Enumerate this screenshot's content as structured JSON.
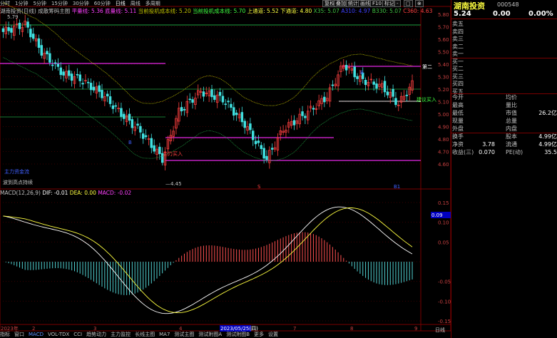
{
  "toolbar": {
    "periods": [
      "分时",
      "1分钟",
      "5分钟",
      "15分钟",
      "30分钟",
      "60分钟",
      "日线",
      "周线",
      "多周期"
    ],
    "selected": "日线",
    "buttons": [
      "复权",
      "叠加",
      "统计",
      "画线",
      "F10",
      "标记",
      "-",
      "□",
      "⊗"
    ]
  },
  "legend_top": {
    "name": "湖南投资(日线)",
    "indicator": "成散筹码主图",
    "items": [
      {
        "label": "平量线:",
        "value": "5.36",
        "color": "#ff40ff"
      },
      {
        "label": "底量线:",
        "value": "5.11",
        "color": "#ff40ff"
      },
      {
        "label": "当前投机成本线:",
        "value": "5.20",
        "color": "#c0c000"
      },
      {
        "label": "当前投机成本线:",
        "value": "5.70",
        "color": "#40ff40"
      },
      {
        "label": "上通道:",
        "value": "5.52",
        "color": "#ffff40"
      },
      {
        "label": "下通道:",
        "value": "4.80",
        "color": "#ffff40"
      },
      {
        "label": "X35:",
        "value": "5.07",
        "color": "#40c040"
      },
      {
        "label": "A310:",
        "value": "4.97",
        "color": "#4040ff"
      },
      {
        "label": "B330:",
        "value": "5.07",
        "color": "#40c040"
      },
      {
        "label": "C360:",
        "value": "4.63",
        "color": "#ff4040"
      }
    ]
  },
  "price_axis": [
    "5.80",
    "5.70",
    "5.60",
    "5.50",
    "5.40",
    "5.30",
    "5.20",
    "5.10",
    "5.00",
    "4.90",
    "4.80",
    "4.70",
    "4.60"
  ],
  "macd_axis": [
    "0.15",
    "0.10",
    "0.05",
    "0.09",
    "-0.05",
    "-0.10",
    "-0.15"
  ],
  "annotations": {
    "high": "5.79",
    "low": "4.45",
    "buy_label": "主力买入",
    "sell_label": "卖出",
    "bottom_left_a": "主力资金流",
    "bottom_left_b": "波到高点持续",
    "right_label_a": "第二",
    "right_label_b": "建议买入",
    "mark_blue": "B1",
    "mark_red": "S",
    "cursor_value": "0.09"
  },
  "macd_legend": {
    "name": "MACD(12,26,9)",
    "dif": "DIF: -0.01",
    "dea": "DEA: 0.00",
    "macd": "MACD: -0.02"
  },
  "date_axis": [
    "2023年",
    "2",
    "3",
    "4",
    "5",
    "2023/05/25(四)",
    "7",
    "8",
    "9"
  ],
  "bottom_tabs": [
    "指标",
    "窗口",
    "MACD",
    "VOL-TDX",
    "CCI",
    "趋势动力",
    "主力监控",
    "长线主图",
    "MA7",
    "测试主图",
    "测试附图A",
    "测试附图B",
    "更多",
    "设置"
  ],
  "bottom_right": "日线",
  "quote": {
    "name": "湖南投资",
    "code": "000548",
    "price": "5.24",
    "change": "0.00",
    "pct": "0.00%",
    "book": [
      {
        "label": "卖五",
        "price": "",
        "vol": ""
      },
      {
        "label": "卖四",
        "price": "",
        "vol": ""
      },
      {
        "label": "卖三",
        "price": "",
        "vol": ""
      },
      {
        "label": "卖二",
        "price": "",
        "vol": ""
      },
      {
        "label": "卖一",
        "price": "",
        "vol": ""
      },
      {
        "label": "买一",
        "price": "",
        "vol": ""
      },
      {
        "label": "买二",
        "price": "",
        "vol": ""
      },
      {
        "label": "买三",
        "price": "",
        "vol": ""
      },
      {
        "label": "买四",
        "price": "",
        "vol": ""
      },
      {
        "label": "买五",
        "price": "",
        "vol": ""
      }
    ],
    "stats": [
      {
        "l1": "今开",
        "v1": "",
        "l2": "均价",
        "v2": ""
      },
      {
        "l1": "最高",
        "v1": "",
        "l2": "量比",
        "v2": ""
      },
      {
        "l1": "最低",
        "v1": "",
        "l2": "市值",
        "v2": "26.2亿"
      },
      {
        "l1": "现量",
        "v1": "",
        "l2": "总量",
        "v2": ""
      },
      {
        "l1": "外盘",
        "v1": "",
        "l2": "内盘",
        "v2": ""
      },
      {
        "l1": "换手",
        "v1": "",
        "l2": "股本",
        "v2": "4.99亿"
      },
      {
        "l1": "净资",
        "v1": "3.78",
        "l2": "流通",
        "v2": "4.99亿"
      },
      {
        "l1": "收益(三)",
        "v1": "0.070",
        "l2": "PE(动)",
        "v2": "35.5"
      }
    ]
  }
}
